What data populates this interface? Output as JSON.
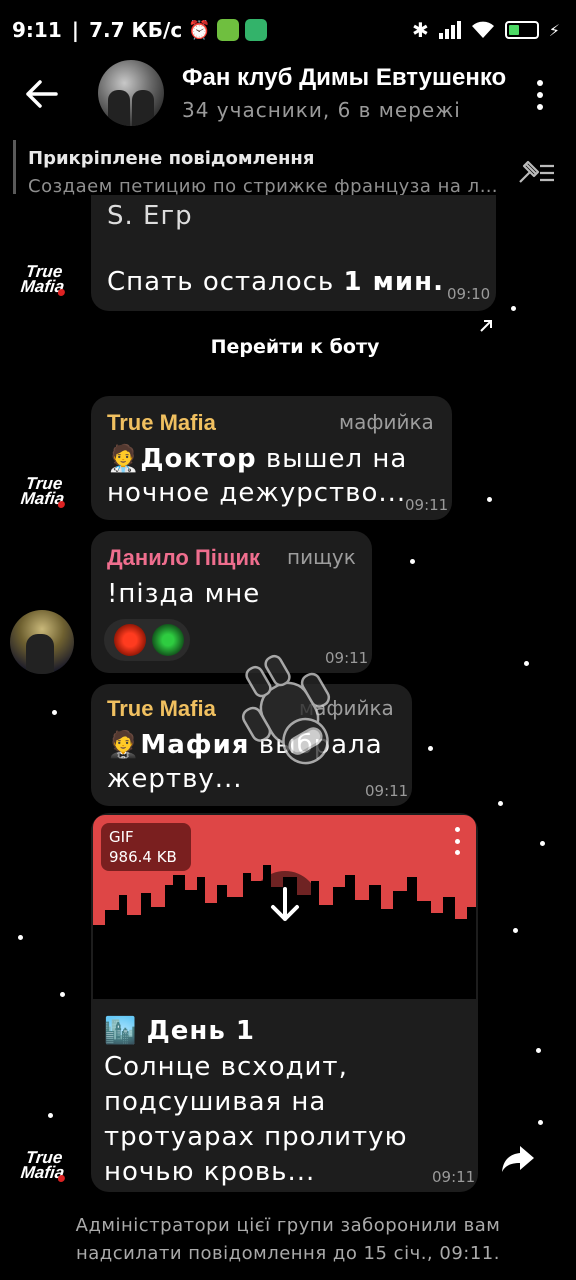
{
  "status_bar": {
    "time": "9:11",
    "speed": "7.7 КБ/с"
  },
  "header": {
    "title": "Фан клуб Димы Евтушенко",
    "subtitle": "34 учасники, 6 в мережі"
  },
  "pinned": {
    "title": "Прикріплене повідомлення",
    "text": "Создаем петицию по стрижке француза на лысо"
  },
  "messages": [
    {
      "sender_avatar": "True Mafia",
      "lines": [
        "S. Егр",
        ""
      ],
      "last_line_prefix": "Спать осталось ",
      "last_line_bold": "1 мин.",
      "time": "09:10"
    },
    {
      "bot_link": "Перейти к боту"
    },
    {
      "sender": "True Mafia",
      "role": "мафийка",
      "emoji": "🧑‍⚕️",
      "bold": "Доктор",
      "text": " вышел на",
      "line2": "ночное дежурство...",
      "time": "09:11"
    },
    {
      "sender": "Данило Піщик",
      "role": "пищук",
      "text": "!пізда мне",
      "time": "09:11"
    },
    {
      "sender": "True Mafia",
      "role": "мафийка",
      "emoji": "🤵",
      "bold": "Мафия",
      "text": " выбрала",
      "line2": "жертву...",
      "time": "09:11"
    },
    {
      "gif_label": "GIF",
      "gif_size": "986.4 KB",
      "emoji": "🏙️",
      "bold": "День 1",
      "lines": [
        "Солнце всходит,",
        "подсушивая на",
        "тротуарах пролитую",
        "ночью кровь..."
      ],
      "time": "09:11"
    }
  ],
  "avatar_label": {
    "line1": "True",
    "line2": "Mafia"
  },
  "footer": {
    "line1": "Адміністратори цієї групи заборонили вам",
    "line2": "надсилати повідомлення до 15 січ., 09:11."
  },
  "colors": {
    "sender_mafia": "#f0c060",
    "sender_user": "#ef6e8e",
    "media_red": "#de4646",
    "bubble": "#1d1d1d"
  }
}
